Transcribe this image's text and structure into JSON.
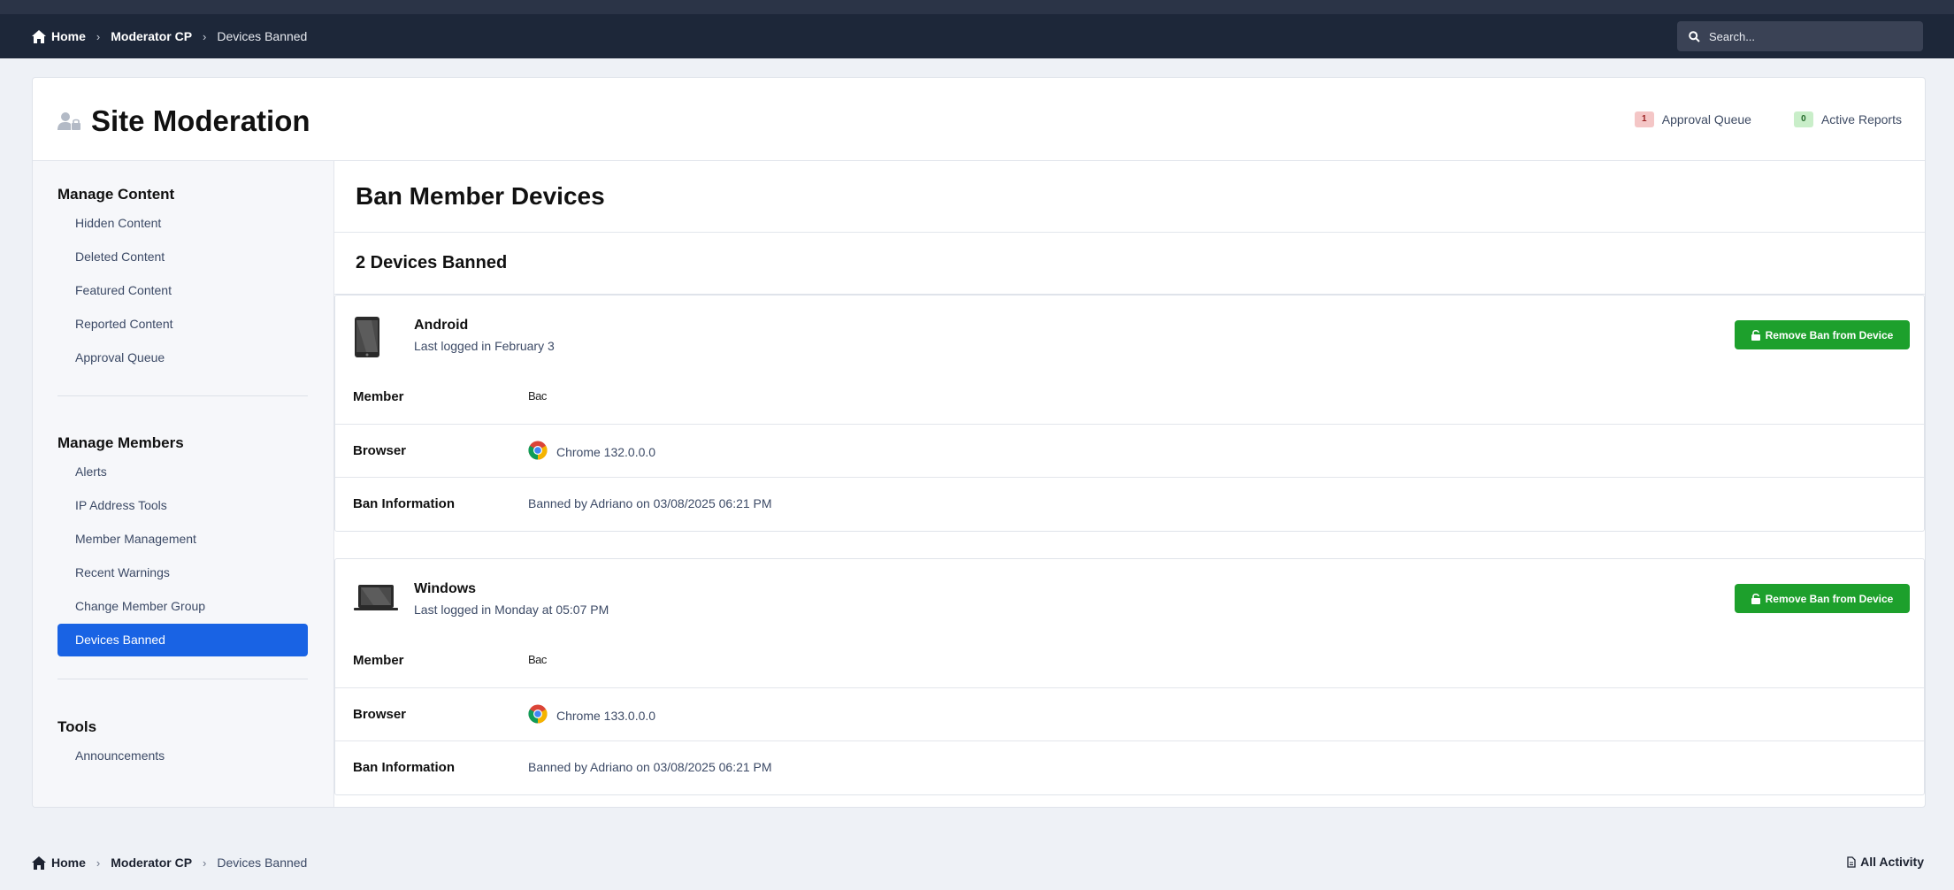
{
  "breadcrumb": {
    "home": "Home",
    "moderator": "Moderator CP",
    "current": "Devices Banned"
  },
  "search": {
    "placeholder": "Search..."
  },
  "header": {
    "title": "Site Moderation",
    "approval_count": "1",
    "approval_label": "Approval Queue",
    "reports_count": "0",
    "reports_label": "Active Reports"
  },
  "sidebar": {
    "sections": [
      {
        "heading": "Manage Content",
        "items": [
          "Hidden Content",
          "Deleted Content",
          "Featured Content",
          "Reported Content",
          "Approval Queue"
        ]
      },
      {
        "heading": "Manage Members",
        "items": [
          "Alerts",
          "IP Address Tools",
          "Member Management",
          "Recent Warnings",
          "Change Member Group",
          "Devices Banned"
        ]
      },
      {
        "heading": "Tools",
        "items": [
          "Announcements"
        ]
      }
    ],
    "active_item": "Devices Banned"
  },
  "main": {
    "title": "Ban Member Devices",
    "count_heading": "2 Devices Banned",
    "remove_button_label": "Remove Ban from Device",
    "labels": {
      "member": "Member",
      "browser": "Browser",
      "ban_info": "Ban Information"
    },
    "devices": [
      {
        "name": "Android",
        "icon": "phone-icon",
        "last_logged": "Last logged in February 3",
        "member": "Bac",
        "browser": "Chrome 132.0.0.0",
        "ban_info": "Banned by Adriano on 03/08/2025 06:21 PM"
      },
      {
        "name": "Windows",
        "icon": "laptop-icon",
        "last_logged": "Last logged in Monday at 05:07 PM",
        "member": "Bac",
        "browser": "Chrome 133.0.0.0",
        "ban_info": "Banned by Adriano on 03/08/2025 06:21 PM"
      }
    ]
  },
  "footer": {
    "all_activity": "All Activity"
  },
  "colors": {
    "accent": "#1963e4",
    "success": "#1da02c",
    "navbar": "#1d2739"
  }
}
